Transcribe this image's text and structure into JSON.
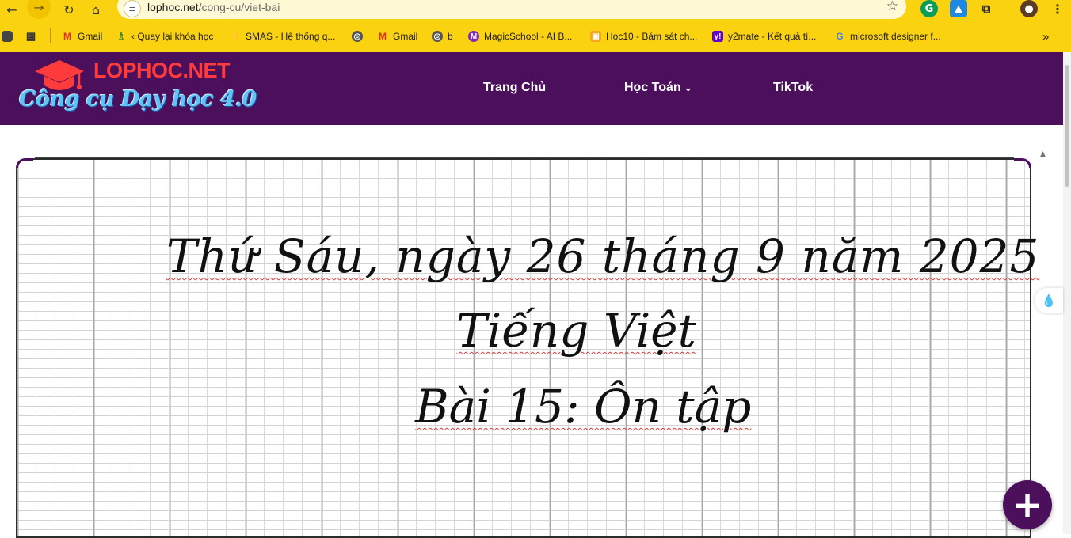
{
  "browser": {
    "url_host": "lophoc.net",
    "url_path": "/cong-cu/viet-bai",
    "nav_icons": {
      "back": "←",
      "forward": "→",
      "reload": "↻",
      "home": "⌂",
      "star": "☆",
      "site_info": "≡"
    },
    "bookmarks": [
      {
        "label": "Gmail",
        "icon": "gmail-icon"
      },
      {
        "label": "‹ Quay lại khóa học",
        "icon": "course-icon"
      },
      {
        "label": "SMAS - Hệ thống q...",
        "icon": "smas-icon"
      },
      {
        "label": "",
        "icon": "globe-icon"
      },
      {
        "label": "Gmail",
        "icon": "gmail-icon"
      },
      {
        "label": "b",
        "icon": "globe-icon"
      },
      {
        "label": "MagicSchool - AI B...",
        "icon": "magicschool-icon"
      },
      {
        "label": "Hoc10 - Bám sát ch...",
        "icon": "hoc10-icon"
      },
      {
        "label": "y2mate - Kết quả tì...",
        "icon": "yahoo-icon"
      },
      {
        "label": "microsoft designer f...",
        "icon": "google-icon"
      }
    ],
    "bookmarks_more": "»",
    "colors": {
      "toolbar": "#fbd20f",
      "omnibox": "#fff9d6"
    }
  },
  "site": {
    "logo_word": "LOPHOC.NET",
    "logo_tagline": "Công cụ Dạy học 4.0",
    "menu": [
      {
        "label": "Trang Chủ",
        "has_dropdown": false
      },
      {
        "label": "Học Toán",
        "has_dropdown": true
      },
      {
        "label": "TikTok",
        "has_dropdown": false
      }
    ],
    "colors": {
      "header": "#4c0f5c",
      "logo_red": "#ff3b3b",
      "logo_blue": "#5fc3f5"
    }
  },
  "board": {
    "lines": [
      "Thứ Sáu, ngày 26 tháng 9 năm 2025",
      "Tiếng Việt",
      "Bài 15: Ôn tập"
    ]
  },
  "fab": {
    "label": "+"
  },
  "side_widget": {
    "icon": "droplet-sparkle-icon",
    "glyph": "💧"
  }
}
